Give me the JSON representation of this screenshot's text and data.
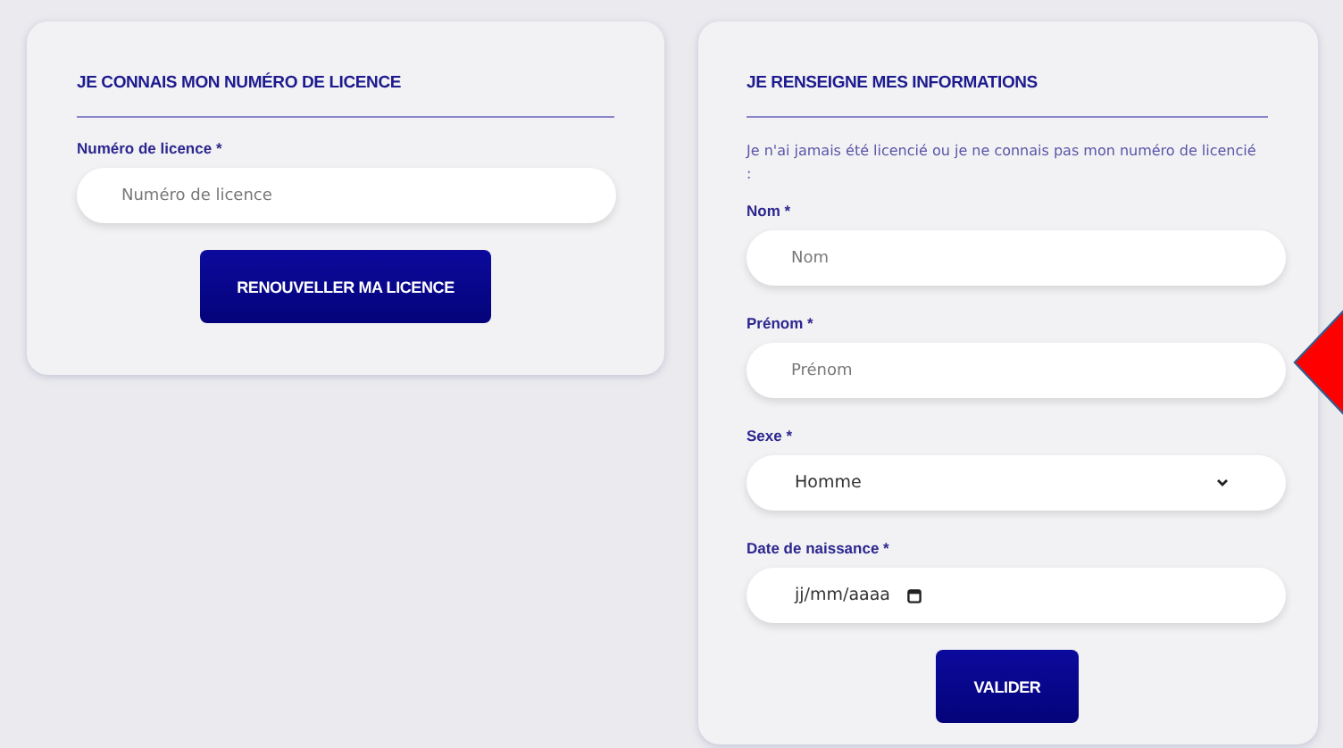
{
  "left_card": {
    "title": "JE CONNAIS MON NUMÉRO DE LICENCE",
    "fields": [
      {
        "kind": "text",
        "label": "Numéro de licence *",
        "placeholder": "Numéro de licence"
      }
    ],
    "button": "RENOUVELLER MA LICENCE"
  },
  "right_card": {
    "title": "JE RENSEIGNE MES INFORMATIONS",
    "intro": "Je n'ai jamais été licencié ou je ne connais pas mon numéro de licencié :",
    "fields": [
      {
        "kind": "text",
        "label": "Nom *",
        "placeholder": "Nom"
      },
      {
        "kind": "text",
        "label": "Prénom *",
        "placeholder": "Prénom"
      },
      {
        "kind": "select",
        "label": "Sexe *",
        "value": "Homme"
      },
      {
        "kind": "date",
        "label": "Date de naissance *",
        "placeholder": "jj/mm/aaaa"
      }
    ],
    "button": "VALIDER"
  }
}
